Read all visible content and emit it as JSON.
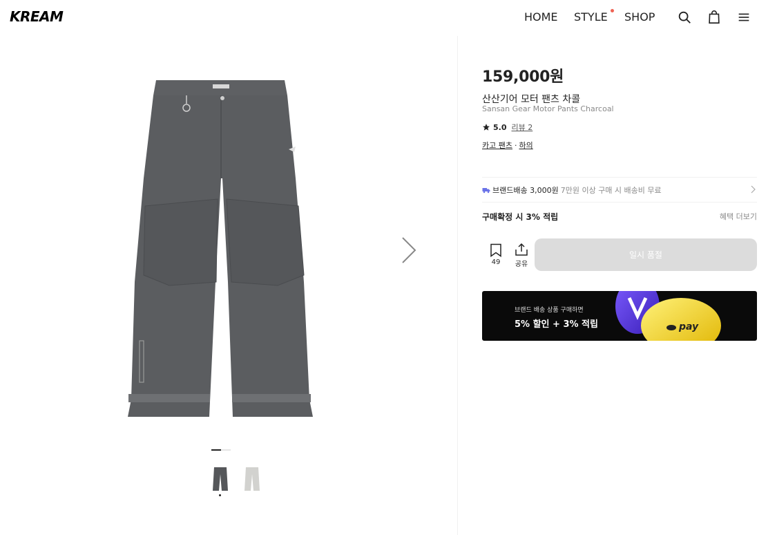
{
  "header": {
    "logo": "KREAM",
    "nav": [
      {
        "label": "HOME"
      },
      {
        "label": "STYLE"
      },
      {
        "label": "SHOP"
      }
    ],
    "icons": [
      "search-icon",
      "shopping-bag-icon",
      "hamburger-menu-icon"
    ],
    "accent_dot_color": "#ef6253"
  },
  "product": {
    "price": "159,000원",
    "name_ko": "산산기어 모터 팬츠 차콜",
    "name_en": "Sansan Gear Motor Pants Charcoal",
    "rating": "5.0",
    "review_link": "리뷰 2",
    "categories": [
      "카고 팬츠",
      "하의"
    ],
    "category_separator": "·",
    "image_count": 2,
    "current_image": 1
  },
  "shipping": {
    "label_bold": "브랜드배송 3,000원",
    "label_light": "7만원 이상 구매 시 배송비 무료"
  },
  "points": {
    "label": "구매확정 시 3% 적립",
    "more": "혜택 더보기"
  },
  "actions": {
    "wish_count": "49",
    "share_label": "공유",
    "soldout_label": "일시 품절"
  },
  "banner": {
    "small_text": "브랜드 배송 상품 구매하면",
    "big_text": "5% 할인 + 3% 적립",
    "pay_logo": "pay"
  },
  "colors": {
    "accent_dot": "#ef6253",
    "truck_icon": "#6a73e8",
    "soldout_button": "#dcdcdc",
    "banner_bg": "#0a0a0a",
    "pants_charcoal": "#5b5d60"
  }
}
